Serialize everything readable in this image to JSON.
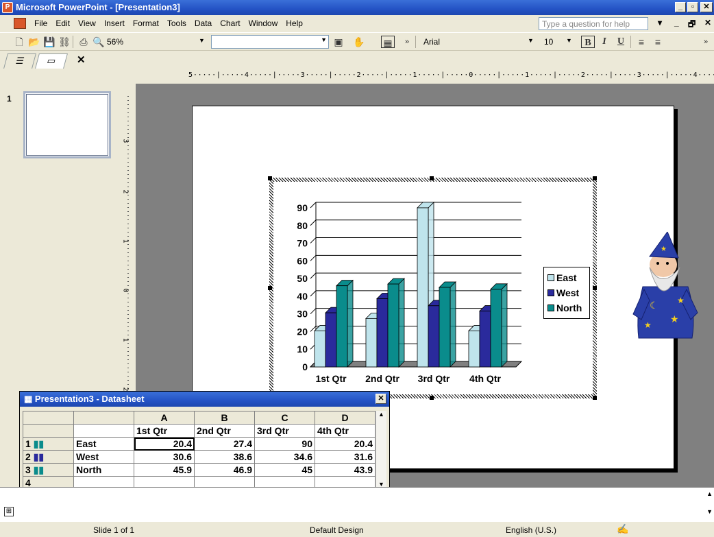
{
  "window": {
    "title": "Microsoft PowerPoint - [Presentation3]",
    "controls": [
      "_",
      "🗗",
      "×"
    ]
  },
  "menubar": {
    "items": [
      "File",
      "Edit",
      "View",
      "Insert",
      "Format",
      "Tools",
      "Data",
      "Chart",
      "Window",
      "Help"
    ],
    "help_placeholder": "Type a question for help"
  },
  "toolbar": {
    "zoom": "56%",
    "font": "Arial",
    "font_size": "10",
    "bold": "B",
    "italic": "I",
    "underline": "U"
  },
  "ruler": {
    "horizontal": "5·····|·····4·····|·····3·····|·····2·····|·····1·····|·····0·····|·····1·····|·····2·····|·····3·····|·····4·····|····",
    "vertical": [
      "3",
      "2",
      "1",
      "0",
      "1",
      "2"
    ]
  },
  "leftpane": {
    "slide_number": "1"
  },
  "chart_data": {
    "type": "bar",
    "categories": [
      "1st Qtr",
      "2nd Qtr",
      "3rd Qtr",
      "4th Qtr"
    ],
    "series": [
      {
        "name": "East",
        "values": [
          20.4,
          27.4,
          90,
          20.4
        ],
        "color": "#bfe4ec"
      },
      {
        "name": "West",
        "values": [
          30.6,
          38.6,
          34.6,
          31.6
        ],
        "color": "#2a2a9c"
      },
      {
        "name": "North",
        "values": [
          45.9,
          46.9,
          45,
          43.9
        ],
        "color": "#0a8c8c"
      }
    ],
    "ylim": [
      0,
      90
    ],
    "yticks": [
      "0",
      "10",
      "20",
      "30",
      "40",
      "50",
      "60",
      "70",
      "80",
      "90"
    ],
    "grid": true,
    "legend": "right"
  },
  "datasheet": {
    "title": "Presentation3 - Datasheet",
    "columns": [
      "A",
      "B",
      "C",
      "D"
    ],
    "header_row": [
      "1st Qtr",
      "2nd Qtr",
      "3rd Qtr",
      "4th Qtr"
    ],
    "rows": [
      {
        "num": "1",
        "label": "East",
        "values": [
          "20.4",
          "27.4",
          "90",
          "20.4"
        ]
      },
      {
        "num": "2",
        "label": "West",
        "values": [
          "30.6",
          "38.6",
          "34.6",
          "31.6"
        ]
      },
      {
        "num": "3",
        "label": "North",
        "values": [
          "45.9",
          "46.9",
          "45",
          "43.9"
        ]
      },
      {
        "num": "4",
        "label": "",
        "values": [
          "",
          "",
          "",
          ""
        ]
      }
    ]
  },
  "statusbar": {
    "slide": "Slide 1 of 1",
    "design": "Default Design",
    "language": "English (U.S.)"
  }
}
